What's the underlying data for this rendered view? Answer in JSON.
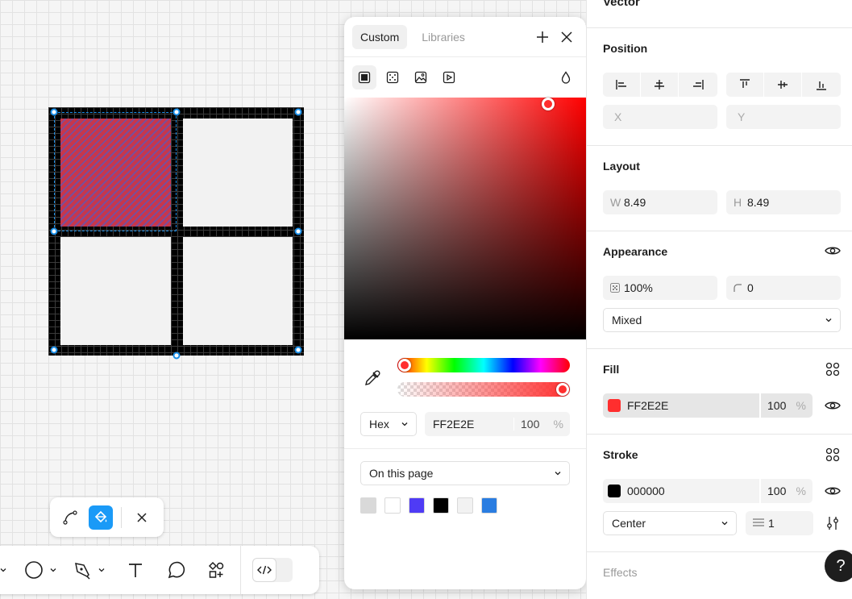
{
  "canvas": {
    "selected_fill": "#FF2E2E"
  },
  "mini_toolbar": {
    "tools": [
      "path-icon",
      "paint-bucket-icon",
      "close-icon"
    ]
  },
  "bottom_toolbar": {
    "tools": [
      "ellipse-icon",
      "pen-icon",
      "text-icon",
      "comment-icon",
      "components-icon",
      "code-icon"
    ]
  },
  "color_picker": {
    "tabs": [
      "Custom",
      "Libraries"
    ],
    "active_tab": "Custom",
    "fill_types": [
      "solid-fill-icon",
      "gradient-fill-icon",
      "image-fill-icon",
      "video-fill-icon"
    ],
    "hue_color": "#FF0000",
    "current_color": "#FF2E2E",
    "format_label": "Hex",
    "hex_value": "FF2E2E",
    "opacity": "100",
    "percent": "%",
    "library_scope": "On this page",
    "swatches": [
      "#D9D9D9",
      "#FFFFFF",
      "#4F3BF5",
      "#000000",
      "#F2F2F2",
      "#2A7DE1"
    ]
  },
  "right_panel": {
    "node_title": "Vector",
    "position": {
      "title": "Position",
      "x_placeholder": "X",
      "y_placeholder": "Y"
    },
    "layout": {
      "title": "Layout",
      "w_label": "W",
      "w_value": "8.49",
      "h_label": "H",
      "h_value": "8.49"
    },
    "appearance": {
      "title": "Appearance",
      "opacity": "100%",
      "radius": "0",
      "blend": "Mixed"
    },
    "fill": {
      "title": "Fill",
      "color": "#FF2E2E",
      "hex": "FF2E2E",
      "opacity": "100",
      "percent": "%"
    },
    "stroke": {
      "title": "Stroke",
      "color": "#000000",
      "hex": "000000",
      "opacity": "100",
      "percent": "%",
      "position": "Center",
      "weight": "1"
    },
    "effects": {
      "title": "Effects"
    },
    "help": "?"
  }
}
